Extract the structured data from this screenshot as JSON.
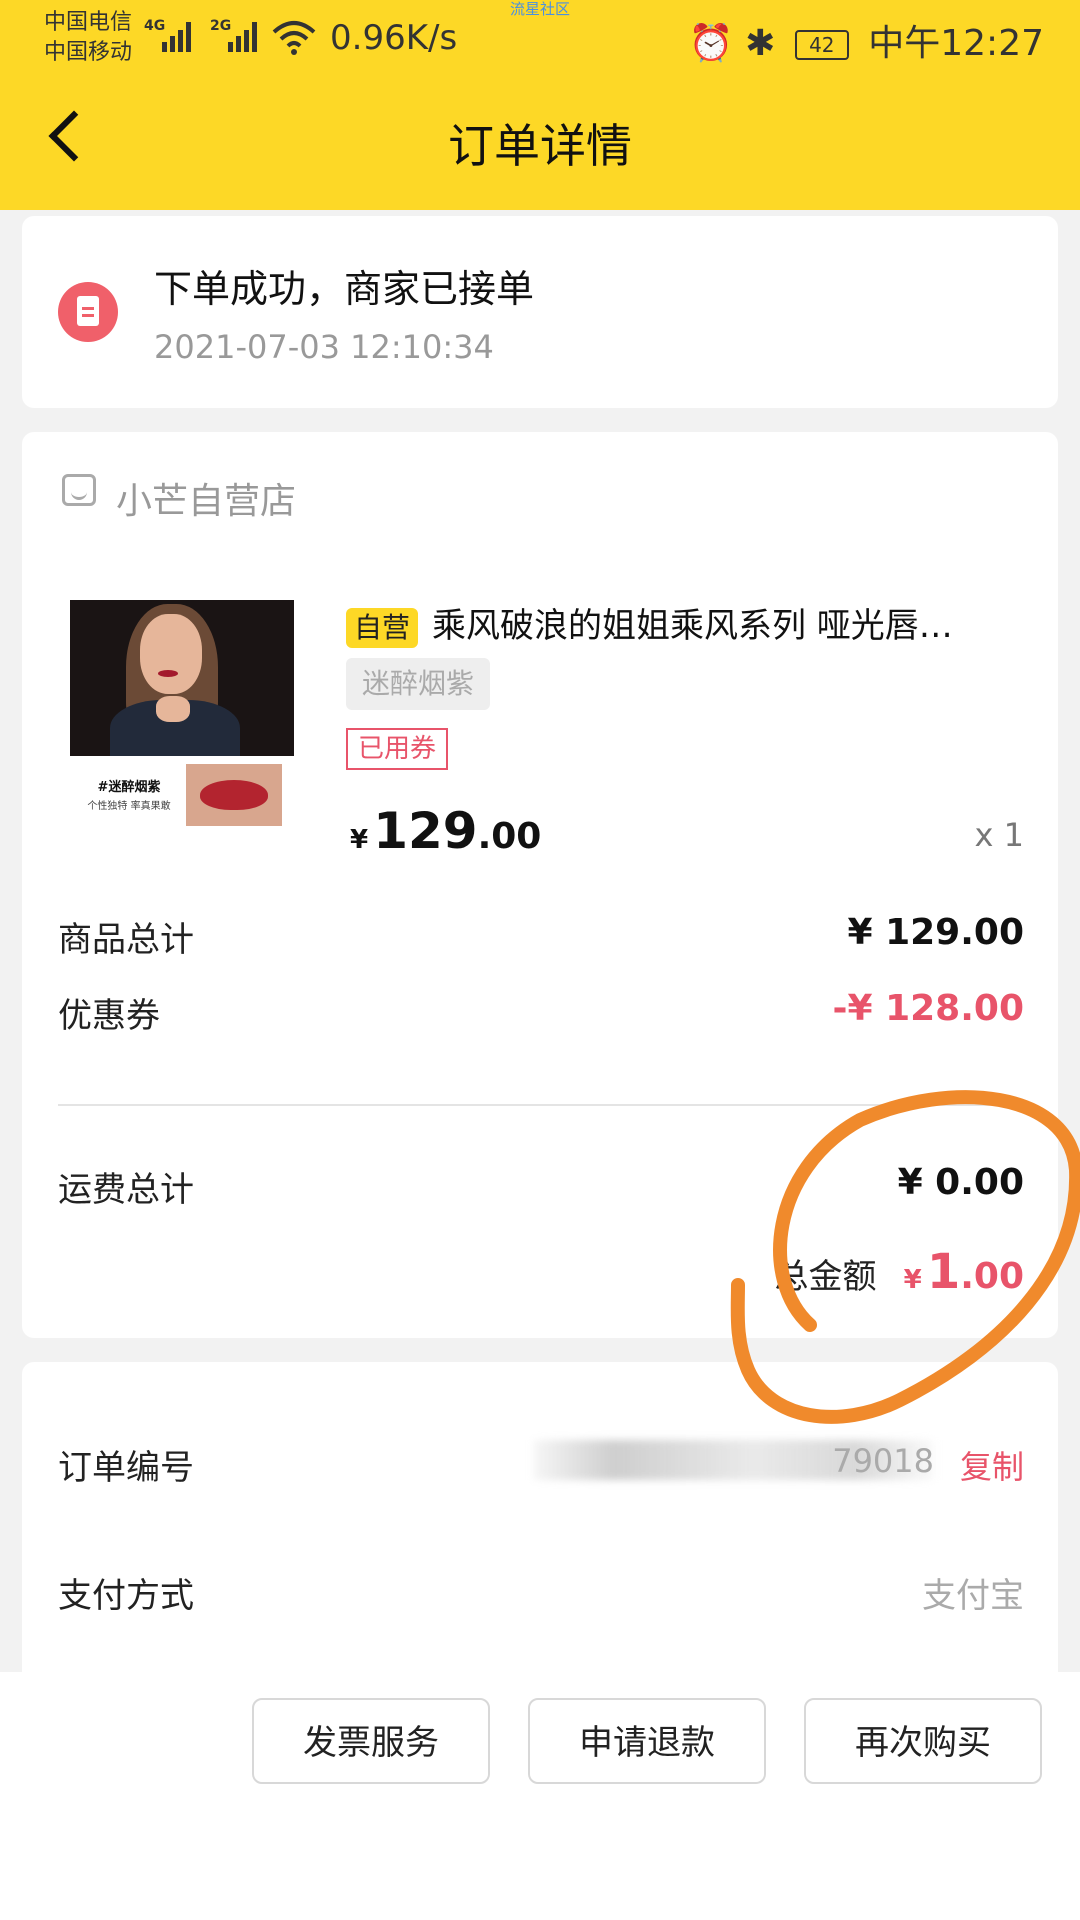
{
  "status_bar": {
    "carrier1": "中国电信",
    "carrier2": "中国移动",
    "net1": "4G",
    "net2": "2G",
    "speed": "0.96K/s",
    "watermark": "流星社区",
    "battery": "42",
    "time": "中午12:27"
  },
  "header": {
    "title": "订单详情"
  },
  "order_status": {
    "title": "下单成功，商家已接单",
    "time": "2021-07-03 12:10:34"
  },
  "shop": {
    "name": "小芒自营店"
  },
  "product": {
    "badge": "自营",
    "title": "乘风破浪的姐姐乘风系列 哑光唇…",
    "image_caption_1": "#迷醉烟紫",
    "image_caption_2": "个性独特 率真果敢",
    "variant": "迷醉烟紫",
    "coupon_tag": "已用券",
    "price_symbol": "¥",
    "price_int": "129",
    "price_dec": ".00",
    "quantity": "x 1"
  },
  "summary": {
    "subtotal_label": "商品总计",
    "subtotal_value": "¥ 129.00",
    "coupon_label": "优惠券",
    "coupon_value": "-¥ 128.00",
    "shipping_label": "运费总计",
    "shipping_value": "¥ 0.00",
    "total_label": "总金额",
    "total_symbol": "¥",
    "total_int": "1",
    "total_dec": ".00"
  },
  "info": {
    "order_no_label": "订单编号",
    "order_no_tail": "79018",
    "copy_label": "复制",
    "payment_label": "支付方式",
    "payment_value": "支付宝"
  },
  "actions": {
    "invoice": "发票服务",
    "refund": "申请退款",
    "rebuy": "再次购买"
  },
  "colors": {
    "brand_yellow": "#fdd826",
    "accent_red": "#e8546a",
    "annotation_orange": "#f08a2c"
  }
}
